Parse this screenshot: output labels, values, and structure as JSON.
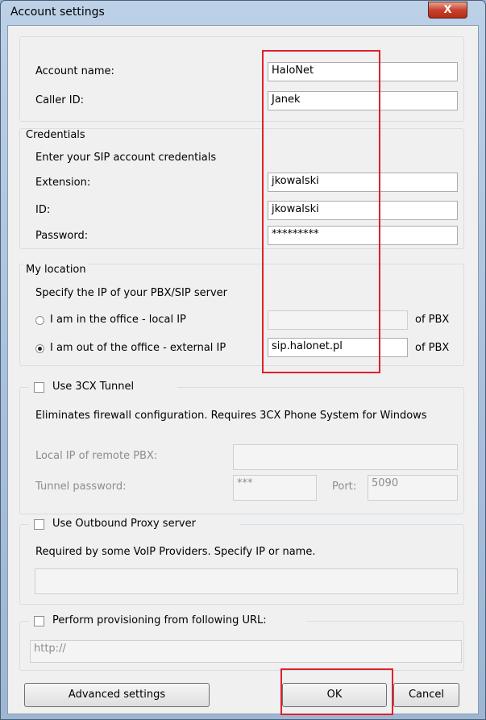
{
  "window": {
    "title": "Account settings",
    "close_label": "X"
  },
  "account": {
    "name_label": "Account name:",
    "name_value": "HaloNet",
    "callerid_label": "Caller ID:",
    "callerid_value": "Janek"
  },
  "credentials": {
    "legend": "Credentials",
    "description": "Enter your SIP account credentials",
    "extension_label": "Extension:",
    "extension_value": "jkowalski",
    "id_label": "ID:",
    "id_value": "jkowalski",
    "password_label": "Password:",
    "password_value": "*********"
  },
  "location": {
    "legend": "My location",
    "description": "Specify the IP of your PBX/SIP server",
    "local_label": "I am in the office - local IP",
    "local_value": "",
    "local_suffix": "of PBX",
    "external_label": "I am out of the office - external IP",
    "external_value": "sip.halonet.pl",
    "external_suffix": "of PBX",
    "selected": "external"
  },
  "tunnel": {
    "checkbox_label": "Use 3CX Tunnel",
    "checked": false,
    "description": "Eliminates firewall configuration. Requires 3CX Phone System for Windows",
    "local_ip_label": "Local IP of remote PBX:",
    "local_ip_value": "",
    "password_label": "Tunnel password:",
    "password_value": "***",
    "port_label": "Port:",
    "port_value": "5090"
  },
  "proxy": {
    "checkbox_label": "Use Outbound Proxy server",
    "checked": false,
    "description": "Required by some VoIP Providers. Specify IP or name.",
    "value": ""
  },
  "provisioning": {
    "checkbox_label": "Perform provisioning from following URL:",
    "checked": false,
    "url_value": "http://"
  },
  "buttons": {
    "advanced": "Advanced settings",
    "ok": "OK",
    "cancel": "Cancel"
  },
  "colors": {
    "highlight": "#e0202a"
  }
}
